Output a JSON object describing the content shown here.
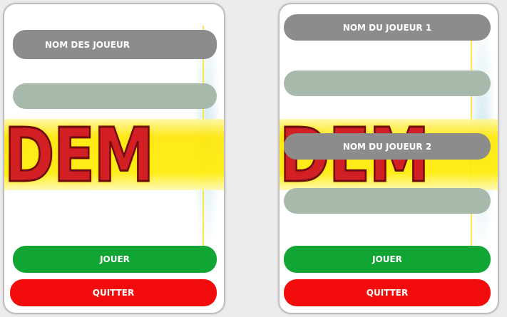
{
  "single_player_screen": {
    "players_label": "NOM DES JOUEUR",
    "name_input_value": "",
    "play_label": "JOUER",
    "quit_label": "QUITTER"
  },
  "two_player_screen": {
    "player1_label": "NOM DU JOUEUR 1",
    "player1_input_value": "",
    "player2_label": "NOM DU JOUEUR 2",
    "player2_input_value": "",
    "play_label": "JOUER",
    "quit_label": "QUITTER"
  },
  "background_logo": {
    "text": "NDEM",
    "icon": "game-logo-artwork"
  },
  "colors": {
    "label_pill": "#8c8c8c",
    "input_pill": "#a7b9aa",
    "play_button": "#11a534",
    "quit_button": "#f20c0c",
    "logo_red": "#d11f24",
    "logo_yellow": "#ffe600"
  }
}
